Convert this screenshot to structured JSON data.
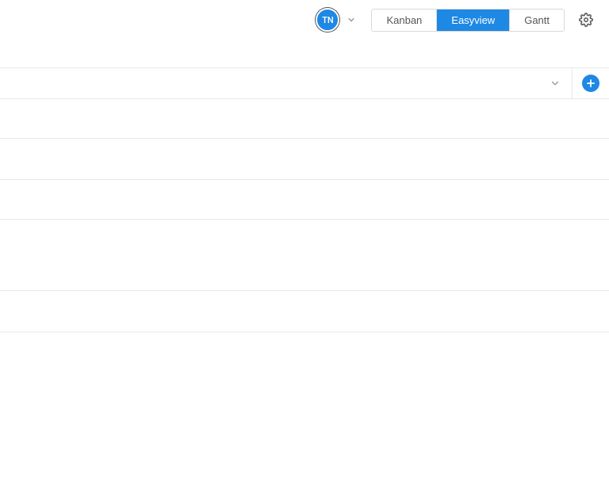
{
  "header": {
    "avatar_initials": "TN",
    "views": [
      {
        "label": "Kanban",
        "active": false
      },
      {
        "label": "Easyview",
        "active": true
      },
      {
        "label": "Gantt",
        "active": false
      }
    ]
  }
}
